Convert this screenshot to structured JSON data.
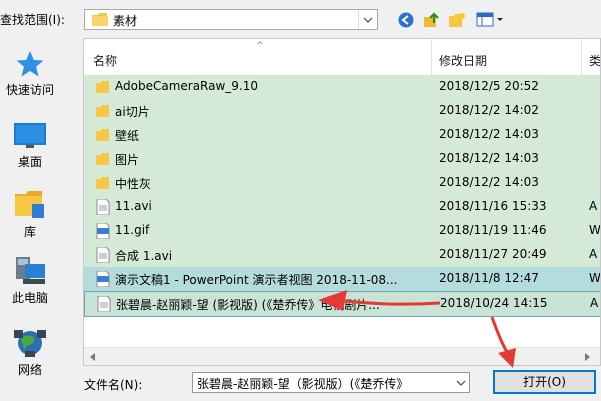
{
  "toolbar": {
    "look_in_label": "查找范围(I):",
    "look_in_value": "素材"
  },
  "sidebar": {
    "items": [
      {
        "label": "快速访问",
        "icon": "star-icon"
      },
      {
        "label": "桌面",
        "icon": "desktop-icon"
      },
      {
        "label": "库",
        "icon": "library-icon"
      },
      {
        "label": "此电脑",
        "icon": "computer-icon"
      },
      {
        "label": "网络",
        "icon": "network-icon"
      }
    ]
  },
  "columns": {
    "name": "名称",
    "date": "修改日期",
    "type": "类"
  },
  "files": [
    {
      "name": "AdobeCameraRaw_9.10",
      "date": "2018/12/5 20:52",
      "type": "",
      "kind": "folder"
    },
    {
      "name": "ai切片",
      "date": "2018/12/2 14:02",
      "type": "",
      "kind": "folder"
    },
    {
      "name": "壁纸",
      "date": "2018/12/2 14:03",
      "type": "",
      "kind": "folder"
    },
    {
      "name": "图片",
      "date": "2018/12/2 14:03",
      "type": "",
      "kind": "folder"
    },
    {
      "name": "中性灰",
      "date": "2018/12/2 14:03",
      "type": "",
      "kind": "folder"
    },
    {
      "name": "11.avi",
      "date": "2018/11/16 15:33",
      "type": "A",
      "kind": "video"
    },
    {
      "name": "11.gif",
      "date": "2018/11/19 11:46",
      "type": "W",
      "kind": "gif"
    },
    {
      "name": "合成 1.avi",
      "date": "2018/11/27 20:49",
      "type": "A",
      "kind": "video"
    },
    {
      "name": "演示文稿1 - PowerPoint 演示者视图 2018-11-08...",
      "date": "2018/11/8 12:47",
      "type": "W",
      "kind": "gif"
    },
    {
      "name": "张碧晨-赵丽颖-望 (影视版) (《楚乔传》电视剧片...",
      "date": "2018/10/24 14:15",
      "type": "A",
      "kind": "video"
    }
  ],
  "footer": {
    "filename_label": "文件名(N):",
    "filename_value": "张碧晨-赵丽颖-望（影视版）(《楚乔传》",
    "open_button": "打开(O)"
  },
  "colors": {
    "row_bg": "#d5ead6",
    "highlight_bg": "#b5dcdc",
    "accent": "#0078d7",
    "arrow": "#e53935"
  }
}
